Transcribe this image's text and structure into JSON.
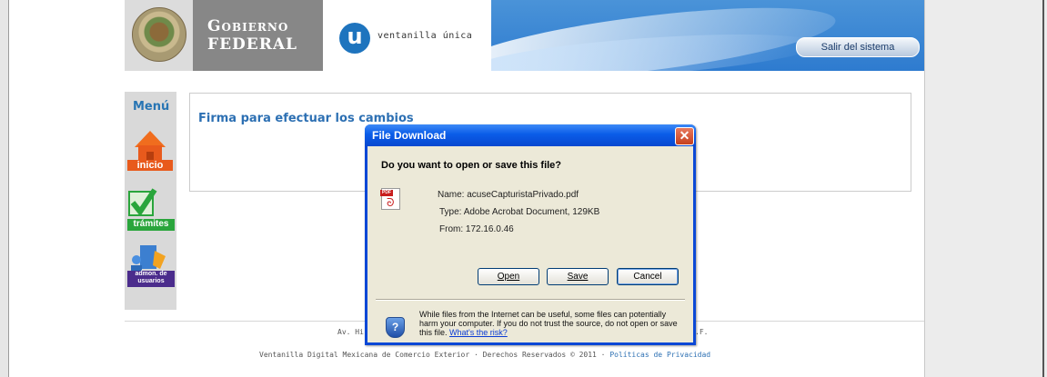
{
  "header": {
    "gobierno_line1": "Gobierno",
    "gobierno_line2": "Federal",
    "vu_letter": "u",
    "vu_text": "ventanilla única",
    "logout_label": "Salir del sistema"
  },
  "menu": {
    "title": "Menú",
    "items": [
      {
        "label": "inicio",
        "icon": "home-icon",
        "color": "#e85a1c"
      },
      {
        "label": "trámites",
        "icon": "checkmark-icon",
        "color": "#2aa53c"
      },
      {
        "label": "admon. de usuarios",
        "icon": "users-icon",
        "color": "#4b2c8c"
      }
    ]
  },
  "content": {
    "title": "Firma para efectuar los cambios"
  },
  "footer": {
    "address_left": "Av. Hi",
    "address_right": ".F.",
    "copyright": "Ventanilla Digital Mexicana de Comercio Exterior · Derechos Reservados © 2011 ·",
    "privacy_link": "Políticas de Privacidad"
  },
  "dialog": {
    "title": "File Download",
    "close_glyph": "✕",
    "question": "Do you want to open or save this file?",
    "file": {
      "name_label": "Name:",
      "name_value": "acuseCapturistaPrivado.pdf",
      "type_label": "Type:",
      "type_value": "Adobe Acrobat Document, 129KB",
      "from_label": "From:",
      "from_value": "172.16.0.46"
    },
    "pdf_tag": "PDF",
    "buttons": {
      "open": "Open",
      "save": "Save",
      "cancel": "Cancel"
    },
    "warning_text": "While files from the Internet can be useful, some files can potentially harm your computer. If you do not trust the source, do not open or save this file.",
    "risk_link": "What's the risk?"
  },
  "colors": {
    "header_blue": "#2e7bcf",
    "title_blue": "#2d70b3",
    "dialog_blue": "#0a5ce8",
    "dialog_face": "#ece9d8"
  }
}
